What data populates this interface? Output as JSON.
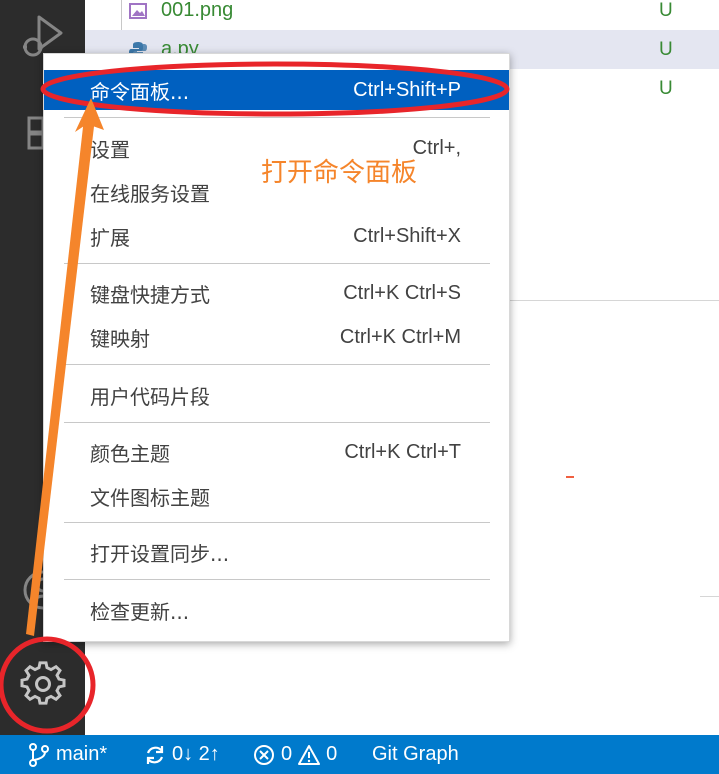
{
  "files": [
    {
      "name": "001.png",
      "status": "U",
      "icon": "image-file-icon"
    },
    {
      "name": "a.py",
      "status": "U",
      "icon": "python-file-icon"
    },
    {
      "name": "",
      "status": "U",
      "icon": ""
    }
  ],
  "menu": {
    "items": [
      {
        "label": "命令面板...",
        "shortcut": "Ctrl+Shift+P"
      },
      {
        "label": "设置",
        "shortcut": "Ctrl+,"
      },
      {
        "label": "在线服务设置",
        "shortcut": ""
      },
      {
        "label": "扩展",
        "shortcut": "Ctrl+Shift+X"
      },
      {
        "label": "键盘快捷方式",
        "shortcut": "Ctrl+K Ctrl+S"
      },
      {
        "label": "键映射",
        "shortcut": "Ctrl+K Ctrl+M"
      },
      {
        "label": "用户代码片段",
        "shortcut": ""
      },
      {
        "label": "颜色主题",
        "shortcut": "Ctrl+K Ctrl+T"
      },
      {
        "label": "文件图标主题",
        "shortcut": ""
      },
      {
        "label": "打开设置同步...",
        "shortcut": ""
      },
      {
        "label": "检查更新...",
        "shortcut": ""
      }
    ]
  },
  "annotation": {
    "text": "打开命令面板"
  },
  "status_bar": {
    "branch": "main*",
    "sync": "0↓ 2↑",
    "errors": "0",
    "warnings": "0",
    "git_graph": "Git Graph"
  },
  "colors": {
    "activity_bar": "#2c2c2c",
    "status_bar": "#007acc",
    "menu_highlight": "#0060c0",
    "untracked_green": "#388a34",
    "annotation_orange": "#f5852b",
    "annotation_red": "#e8252a"
  }
}
